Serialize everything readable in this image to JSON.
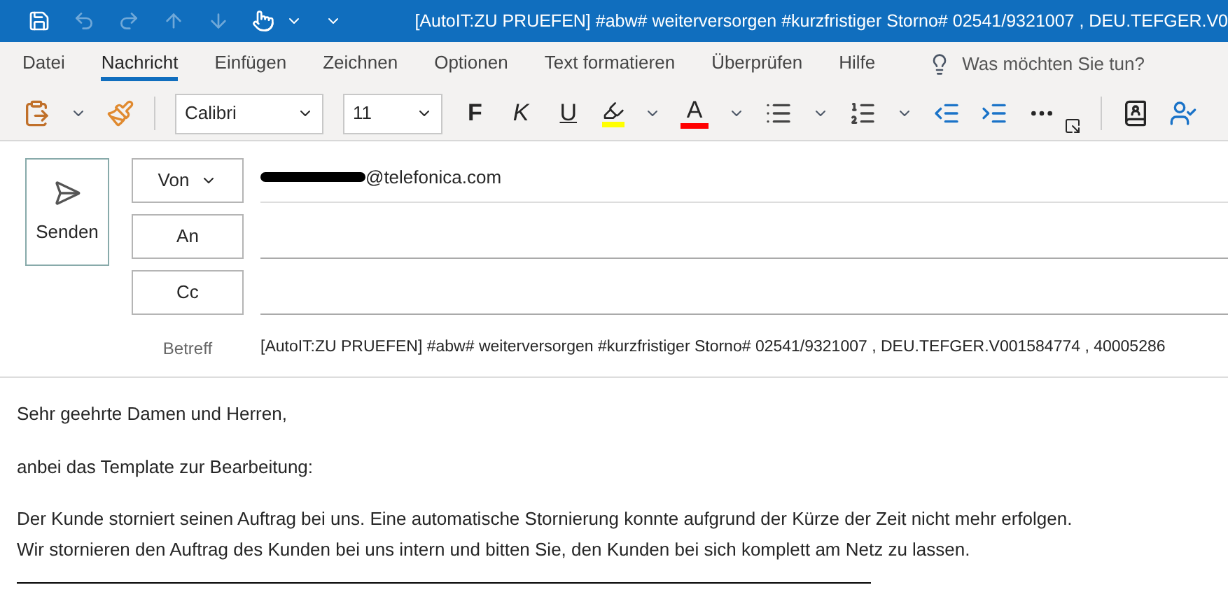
{
  "title_bar": {
    "title": "[AutoIT:ZU PRUEFEN] #abw# weiterversorgen #kurzfristiger Storno# 02541/9321007 , DEU.TEFGER.V0"
  },
  "ribbon_tabs": [
    {
      "label": "Datei",
      "selected": false
    },
    {
      "label": "Nachricht",
      "selected": true
    },
    {
      "label": "Einfügen",
      "selected": false
    },
    {
      "label": "Zeichnen",
      "selected": false
    },
    {
      "label": "Optionen",
      "selected": false
    },
    {
      "label": "Text formatieren",
      "selected": false
    },
    {
      "label": "Überprüfen",
      "selected": false
    },
    {
      "label": "Hilfe",
      "selected": false
    }
  ],
  "tell_me": {
    "placeholder": "Was möchten Sie tun?"
  },
  "toolbar": {
    "font": "Calibri",
    "size": "11",
    "bold": "F",
    "italic": "K",
    "underline": "U",
    "font_color": "A"
  },
  "compose": {
    "send": "Senden",
    "from_label": "Von",
    "from_address": "@telefonica.com",
    "to_label": "An",
    "cc_label": "Cc",
    "subject_label": "Betreff",
    "subject": "[AutoIT:ZU PRUEFEN] #abw# weiterversorgen #kurzfristiger Storno# 02541/9321007 , DEU.TEFGER.V001584774 , 40005286"
  },
  "body": {
    "paragraphs": [
      [
        "Sehr geehrte Damen und Herren,"
      ],
      [
        "anbei das Template zur Bearbeitung:"
      ],
      [
        "Der Kunde storniert seinen Auftrag bei uns. Eine automatische Stornierung konnte aufgrund der Kürze der Zeit nicht mehr erfolgen.",
        "Wir stornieren den Auftrag des Kunden bei uns intern und bitten Sie, den Kunden bei sich komplett am Netz zu lassen."
      ]
    ]
  }
}
